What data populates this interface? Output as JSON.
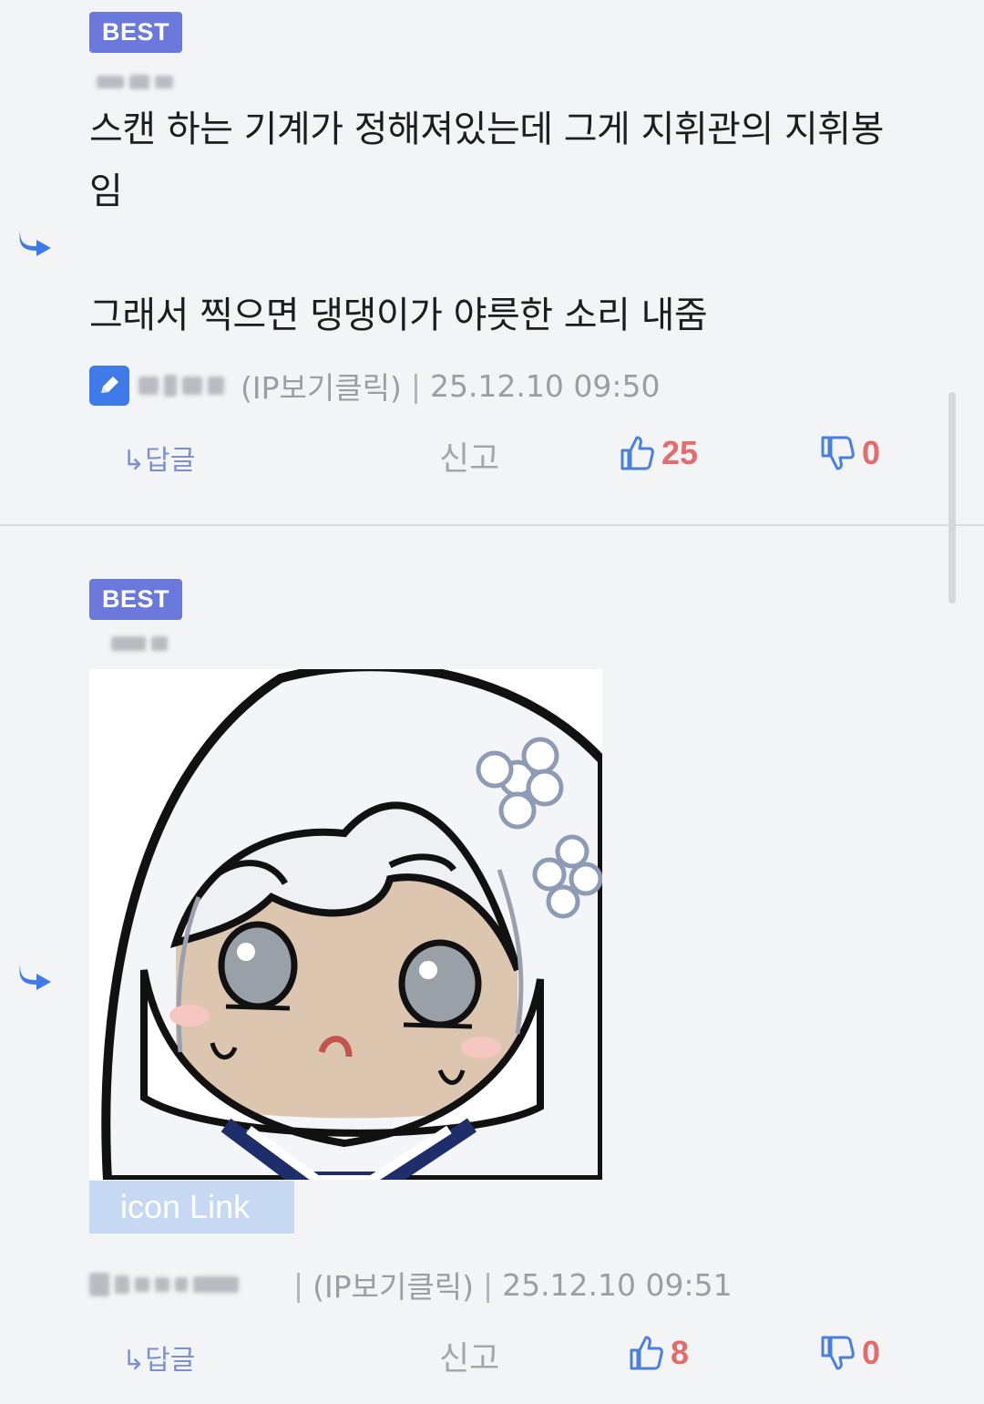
{
  "comments": [
    {
      "badge": "BEST",
      "lines": [
        "스캔 하는 기계가 정해져있는데 그게 지휘관의 지휘봉",
        "임",
        "그래서 찍으면 댕댕이가 야릇한 소리 내줌"
      ],
      "ip_label": "(IP보기클릭)",
      "separator": "|",
      "timestamp": "25.12.10 09:50",
      "reply_label": "↳답글",
      "report_label": "신고",
      "likes": "25",
      "dislikes": "0"
    },
    {
      "badge": "BEST",
      "link_label": "icon Link",
      "ip_label": "(IP보기클릭)",
      "separator": "|",
      "timestamp": "25.12.10 09:51",
      "reply_label": "↳답글",
      "report_label": "신고",
      "likes": "8",
      "dislikes": "0"
    }
  ],
  "colors": {
    "badge": "#6b79dc",
    "accent_count": "#e36b6b",
    "reply_link": "#7c8fce",
    "thumb_icon": "#4a7fe0"
  },
  "icons": [
    "reply-arrow-icon",
    "pencil-icon",
    "thumbs-up-icon",
    "thumbs-down-icon"
  ]
}
